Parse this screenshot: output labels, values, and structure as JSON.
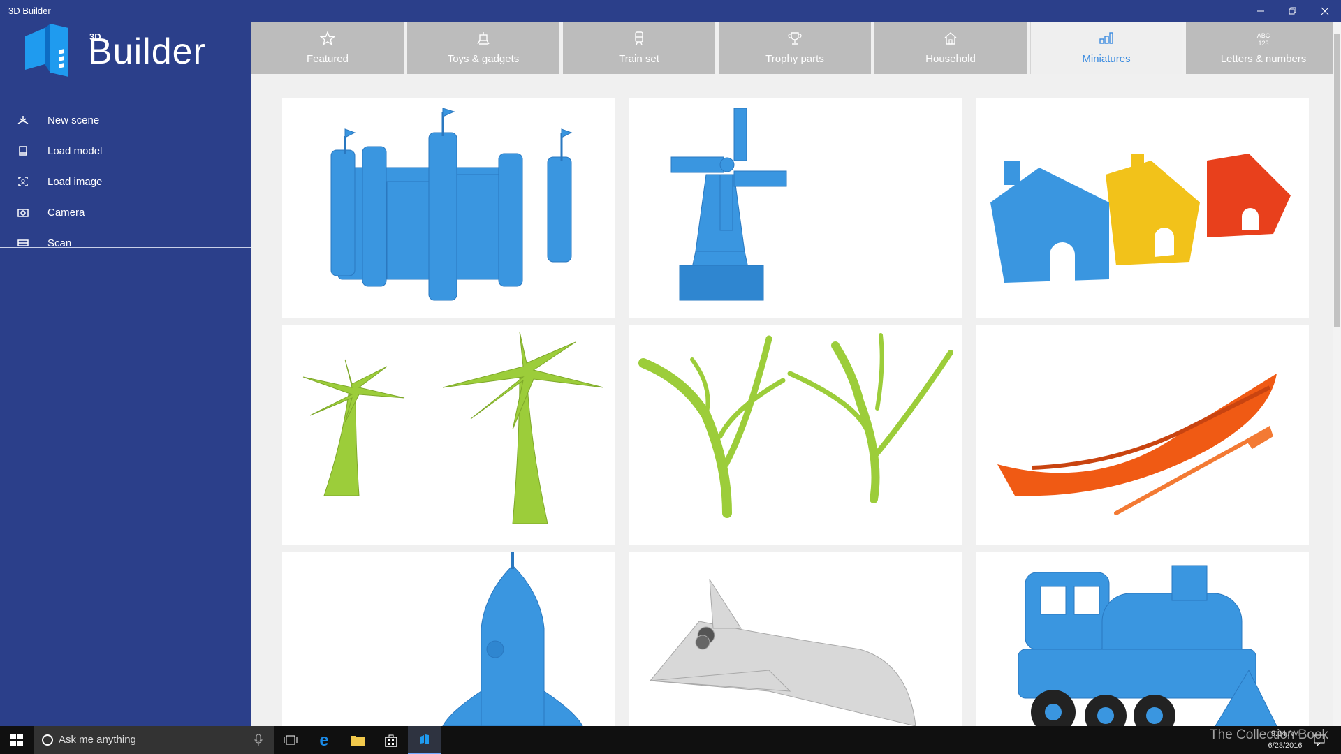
{
  "window": {
    "title": "3D Builder"
  },
  "logo": {
    "prefix": "3D",
    "name": "Builder"
  },
  "menu": {
    "items": [
      {
        "label": "New scene",
        "icon": "new-scene-icon"
      },
      {
        "label": "Load model",
        "icon": "load-model-icon"
      },
      {
        "label": "Load image",
        "icon": "load-image-icon"
      },
      {
        "label": "Camera",
        "icon": "camera-icon"
      },
      {
        "label": "Scan",
        "icon": "scan-icon"
      }
    ]
  },
  "tabs": [
    {
      "label": "Featured",
      "icon": "star-icon"
    },
    {
      "label": "Toys & gadgets",
      "icon": "robot-icon"
    },
    {
      "label": "Train set",
      "icon": "train-icon"
    },
    {
      "label": "Trophy parts",
      "icon": "trophy-icon"
    },
    {
      "label": "Household",
      "icon": "house-icon"
    },
    {
      "label": "Miniatures",
      "icon": "miniatures-icon",
      "active": true
    },
    {
      "label": "Letters & numbers",
      "icon": "abc-123-icon"
    }
  ],
  "models": [
    {
      "name": "castle",
      "color": "#3a96e0"
    },
    {
      "name": "windmill",
      "color": "#3a96e0"
    },
    {
      "name": "houses",
      "colors": [
        "#3a96e0",
        "#f2c21a",
        "#e8401c"
      ]
    },
    {
      "name": "palm-trees",
      "color": "#9ccd3a"
    },
    {
      "name": "trees",
      "color": "#9ccd3a"
    },
    {
      "name": "rowboat",
      "color": "#f05a14"
    },
    {
      "name": "rocket",
      "color": "#3a96e0"
    },
    {
      "name": "space-shuttle",
      "color": "#d0d0d0"
    },
    {
      "name": "locomotive",
      "color": "#3a96e0"
    }
  ],
  "taskbar": {
    "search_placeholder": "Ask me anything",
    "time": "9:24 AM",
    "date": "6/23/2016"
  },
  "watermark": "The Collection Book",
  "colors": {
    "sidebar": "#2b3f8a",
    "accent": "#3a8be0",
    "tab_inactive": "#bcbcbc"
  }
}
